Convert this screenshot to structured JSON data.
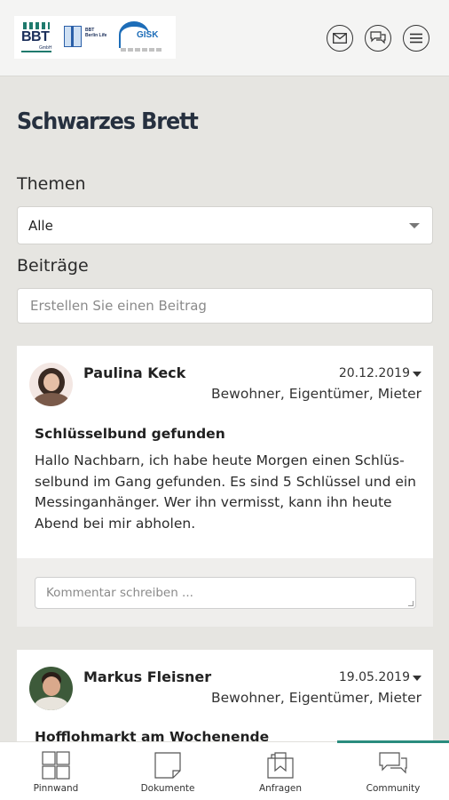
{
  "header": {
    "logos": [
      {
        "name": "bbt-logo",
        "text": "BBT",
        "sub": "GmbH"
      },
      {
        "name": "bbt-berlin-life-logo",
        "text": "BBT Berlin Life"
      },
      {
        "name": "gisk-logo",
        "text": "GISK"
      }
    ],
    "icons": [
      "mail-icon",
      "chat-icon",
      "menu-icon"
    ]
  },
  "main": {
    "title": "Schwarzes Brett",
    "topics_label": "Themen",
    "topics_selected": "Alle",
    "posts_label": "Beiträge",
    "create_post_placeholder": "Erstellen Sie einen Beitrag"
  },
  "posts": [
    {
      "author": "Paulina Keck",
      "date": "20.12.2019",
      "roles": "Bewohner, Eigentümer, Mieter",
      "title": "Schlüsselbund gefunden",
      "body": "Hallo Nachbarn, ich habe heute Morgen einen Schlüs­selbund im Gang gefunden. Es sind 5 Schlüssel und ein Messinganhänger. Wer ihn vermisst, kann ihn heute Abend bei mir abholen.",
      "comment_placeholder": "Kommentar schreiben ..."
    },
    {
      "author": "Markus Fleisner",
      "date": "19.05.2019",
      "roles": "Bewohner, Eigentümer, Mieter",
      "title": "Hofflohmarkt am Wochenende"
    }
  ],
  "nav": {
    "items": [
      {
        "label": "Pinnwand",
        "icon": "grid-icon"
      },
      {
        "label": "Dokumente",
        "icon": "document-icon"
      },
      {
        "label": "Anfragen",
        "icon": "inbox-icon"
      },
      {
        "label": "Community",
        "icon": "community-chat-icon"
      }
    ],
    "active": "Community",
    "accent_color": "#2a8c7e"
  }
}
